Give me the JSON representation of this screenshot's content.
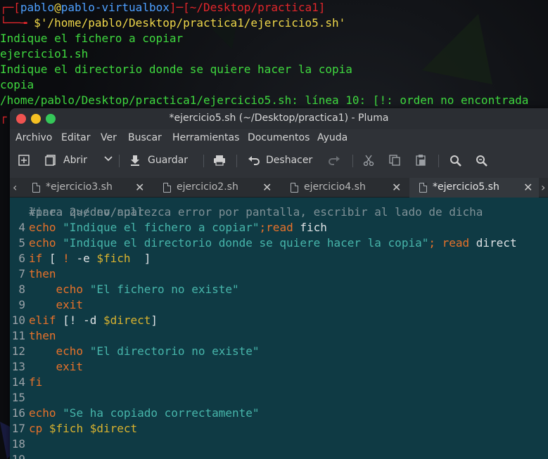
{
  "terminal": {
    "prompt_user": "pablo",
    "prompt_at": "@",
    "prompt_host": "pablo-virtualbox",
    "prompt_path": "[~/Desktop/practica1]",
    "prompt_open": "┌─[",
    "prompt_close": "]─",
    "prompt_second": "└──╼ ",
    "command": "'/home/pablo/Desktop/practica1/ejercicio5.sh'",
    "dollar": "$",
    "output": [
      "Indique el fichero a copiar",
      "ejercicio1.sh",
      "Indique el directorio donde se quiere hacer la copia",
      "copia",
      "/home/pablo/Desktop/practica1/ejercicio5.sh: línea 10: [!: orden no encontrada"
    ]
  },
  "window": {
    "title": "*ejercicio5.sh (~/Desktop/practica1) - Pluma",
    "colors": {
      "close": "#ef5350",
      "minimize": "#f5c023",
      "maximize": "#35c759"
    }
  },
  "menubar": {
    "items": [
      "Archivo",
      "Editar",
      "Ver",
      "Buscar",
      "Herramientas",
      "Documentos",
      "Ayuda"
    ]
  },
  "toolbar": {
    "open_label": "Abrir",
    "save_label": "Guardar",
    "undo_label": "Deshacer"
  },
  "tabs": [
    {
      "label": "*ejercicio3.sh",
      "close": "✕"
    },
    {
      "label": "ejercicio2.sh",
      "close": "✕"
    },
    {
      "label": "ejercicio4.sh",
      "close": "✕"
    },
    {
      "label": "*ejercicio5.sh",
      "close": "✕"
    }
  ],
  "editor": {
    "partial_line": "#para que no aparezca error por pantalla, escribir al lado de dicha",
    "lines": [
      {
        "num": "",
        "tokens": [
          {
            "t": "linea 2>/dev/null",
            "c": "cm"
          }
        ]
      },
      {
        "num": "4",
        "tokens": [
          {
            "t": "echo ",
            "c": "kw"
          },
          {
            "t": "\"Indique el fichero a copiar\"",
            "c": "st"
          },
          {
            "t": ";",
            "c": "kw"
          },
          {
            "t": "read",
            "c": "kw"
          },
          {
            "t": " fich",
            "c": "pl"
          }
        ]
      },
      {
        "num": "5",
        "tokens": [
          {
            "t": "echo ",
            "c": "kw"
          },
          {
            "t": "\"Indique el directorio donde se quiere hacer la copia\"",
            "c": "st"
          },
          {
            "t": "; ",
            "c": "kw"
          },
          {
            "t": "read",
            "c": "kw"
          },
          {
            "t": " direct",
            "c": "pl"
          }
        ]
      },
      {
        "num": "6",
        "tokens": [
          {
            "t": "if",
            "c": "kw"
          },
          {
            "t": " [ ",
            "c": "pl"
          },
          {
            "t": "!",
            "c": "kw"
          },
          {
            "t": " -e ",
            "c": "pl"
          },
          {
            "t": "$fich",
            "c": "vr"
          },
          {
            "t": "  ]",
            "c": "pl"
          }
        ]
      },
      {
        "num": "7",
        "tokens": [
          {
            "t": "then",
            "c": "kw"
          }
        ]
      },
      {
        "num": "8",
        "tokens": [
          {
            "t": "    echo ",
            "c": "kw"
          },
          {
            "t": "\"El fichero no existe\"",
            "c": "st"
          }
        ]
      },
      {
        "num": "9",
        "tokens": [
          {
            "t": "    exit",
            "c": "kw"
          }
        ]
      },
      {
        "num": "10",
        "tokens": [
          {
            "t": "elif",
            "c": "kw"
          },
          {
            "t": " [! -d ",
            "c": "pl"
          },
          {
            "t": "$direct",
            "c": "vr"
          },
          {
            "t": "]",
            "c": "pl"
          }
        ]
      },
      {
        "num": "11",
        "tokens": [
          {
            "t": "then",
            "c": "kw"
          }
        ]
      },
      {
        "num": "12",
        "tokens": [
          {
            "t": "    echo ",
            "c": "kw"
          },
          {
            "t": "\"El directorio no existe\"",
            "c": "st"
          }
        ]
      },
      {
        "num": "13",
        "tokens": [
          {
            "t": "    exit",
            "c": "kw"
          }
        ]
      },
      {
        "num": "14",
        "tokens": [
          {
            "t": "fi",
            "c": "kw"
          }
        ]
      },
      {
        "num": "15",
        "tokens": []
      },
      {
        "num": "16",
        "tokens": [
          {
            "t": "echo ",
            "c": "kw"
          },
          {
            "t": "\"Se ha copiado correctamente\"",
            "c": "st"
          }
        ]
      },
      {
        "num": "17",
        "tokens": [
          {
            "t": "cp ",
            "c": "kw"
          },
          {
            "t": "$fich",
            "c": "vr"
          },
          {
            "t": " ",
            "c": "pl"
          },
          {
            "t": "$direct",
            "c": "vr"
          }
        ]
      },
      {
        "num": "18",
        "tokens": []
      },
      {
        "num": "19",
        "tokens": []
      }
    ]
  }
}
